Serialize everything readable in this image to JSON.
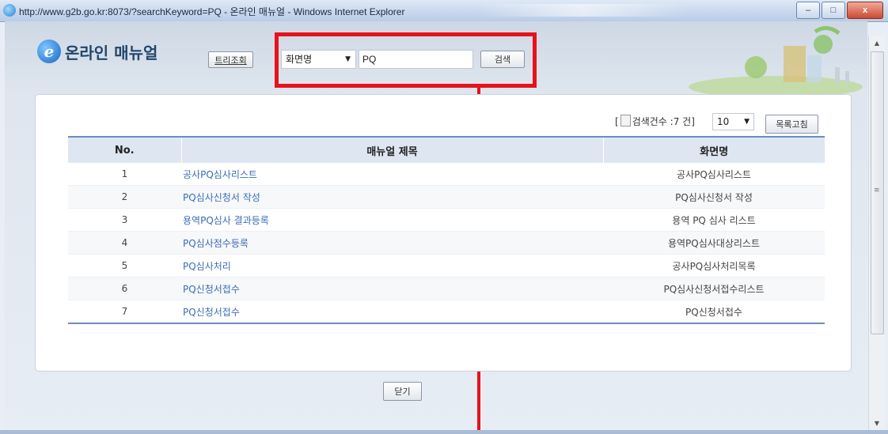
{
  "window": {
    "title": "http://www.g2b.go.kr:8073/?searchKeyword=PQ - 온라인 매뉴얼 - Windows Internet Explorer",
    "min_label": "–",
    "max_label": "□",
    "close_label": "x"
  },
  "header": {
    "logo_glyph": "e",
    "logo_text": "온라인 매뉴얼",
    "tree_button": "트리조회",
    "search_type": "화면명",
    "search_value": "PQ",
    "search_button": "검색"
  },
  "listing": {
    "count_prefix": "[",
    "count_text": "검색건수 :7 건]",
    "page_size": "10",
    "refresh_button": "목록고침"
  },
  "table": {
    "columns": [
      "No.",
      "매뉴얼 제목",
      "화면명"
    ],
    "rows": [
      {
        "no": "1",
        "title": "공사PQ심사리스트",
        "screen": "공사PQ심사리스트"
      },
      {
        "no": "2",
        "title": "PQ심사신청서 작성",
        "screen": "PQ심사신청서 작성"
      },
      {
        "no": "3",
        "title": "용역PQ심사 결과등록",
        "screen": "용역 PQ 심사 리스트"
      },
      {
        "no": "4",
        "title": "PQ심사점수등록",
        "screen": "용역PQ심사대상리스트"
      },
      {
        "no": "5",
        "title": "PQ심사처리",
        "screen": "공사PQ심사처리목록"
      },
      {
        "no": "6",
        "title": "PQ신청서접수",
        "screen": "PQ심사신청서접수리스트"
      },
      {
        "no": "7",
        "title": "PQ신청서접수",
        "screen": "PQ신청서접수"
      }
    ]
  },
  "footer": {
    "close_button": "닫기"
  },
  "colors": {
    "highlight": "#e8121a",
    "link": "#3b6db4",
    "table_header_bg": "#dde6f1",
    "table_rule": "#6b8cc0"
  }
}
